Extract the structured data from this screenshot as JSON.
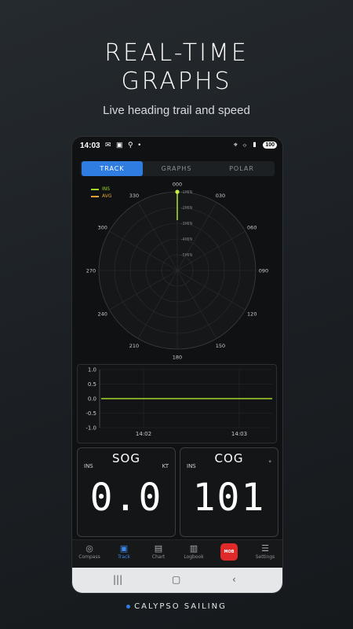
{
  "headline": {
    "line1": "REAL-TIME",
    "line2": "GRAPHS"
  },
  "subtitle": "Live heading trail and speed",
  "statusbar": {
    "time": "14:03",
    "battery": "100"
  },
  "tabs": [
    {
      "label": "TRACK",
      "active": true
    },
    {
      "label": "GRAPHS",
      "active": false
    },
    {
      "label": "POLAR",
      "active": false
    }
  ],
  "legend": [
    {
      "label": "INS",
      "color": "#9fd62a"
    },
    {
      "label": "AVG",
      "color": "#e8a33a"
    }
  ],
  "polar": {
    "bearings": [
      "000",
      "030",
      "060",
      "090",
      "120",
      "150",
      "180",
      "210",
      "240",
      "270",
      "300",
      "330"
    ],
    "rings": [
      "-1MIN",
      "-2MIN",
      "-3MIN",
      "-4MIN",
      "-5MIN"
    ],
    "heading_trail_deg": 0
  },
  "chart_data": {
    "type": "line",
    "y_ticks": [
      "1.0",
      "0.5",
      "0.0",
      "-0.5",
      "-1.0"
    ],
    "ylim": [
      -1.0,
      1.0
    ],
    "x_ticks": [
      "14:02",
      "14:03"
    ],
    "series": [
      {
        "values": [
          0.0,
          0.0
        ],
        "color": "#a8d32a"
      }
    ]
  },
  "sog": {
    "title": "SOG",
    "left_label": "INS",
    "unit": "KT",
    "value": "0.0"
  },
  "cog": {
    "title": "COG",
    "left_label": "INS",
    "value": "101"
  },
  "nav": [
    {
      "label": "Compass",
      "icon": "compass-icon",
      "active": false
    },
    {
      "label": "Track",
      "icon": "track-icon",
      "active": true
    },
    {
      "label": "Chart",
      "icon": "map-icon",
      "active": false
    },
    {
      "label": "Logbook",
      "icon": "book-icon",
      "active": false
    },
    {
      "label": "MOB",
      "icon": "mob-icon",
      "active": false
    },
    {
      "label": "Settings",
      "icon": "sliders-icon",
      "active": false
    }
  ],
  "brand": "CALYPSO SAILING"
}
